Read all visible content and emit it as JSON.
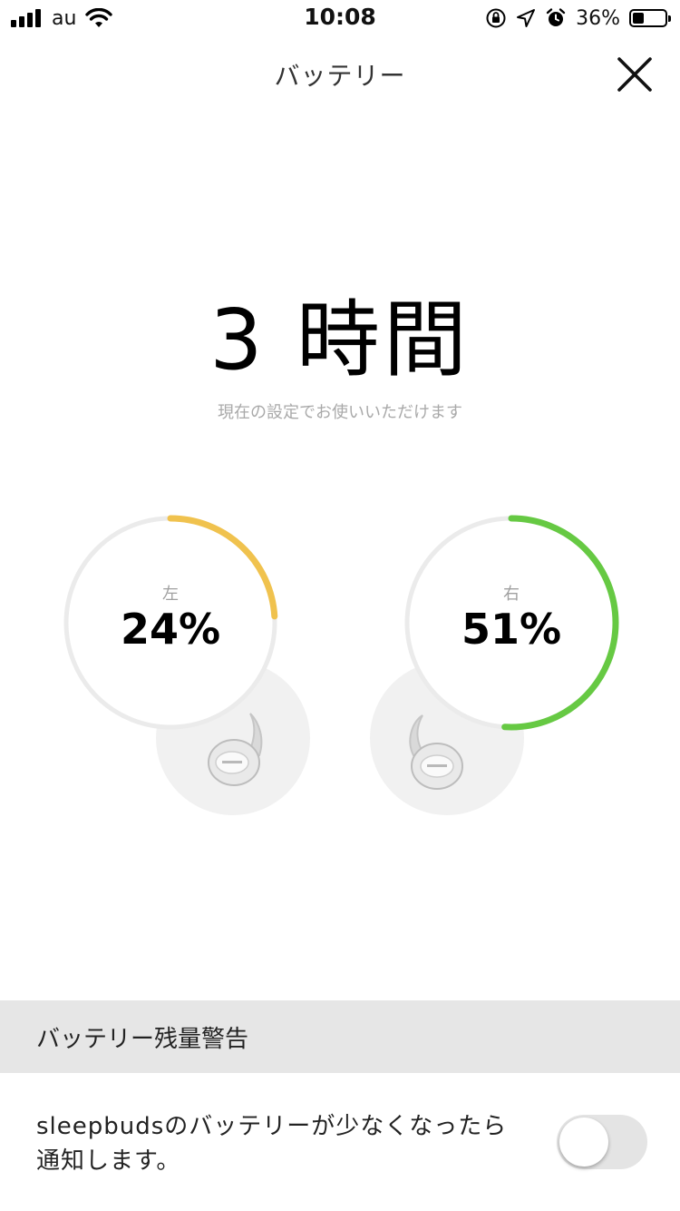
{
  "status_bar": {
    "carrier": "au",
    "time": "10:08",
    "battery_text": "36%",
    "battery_level": 0.36,
    "icons": [
      "signal-icon",
      "wifi-icon",
      "orientation-lock-icon",
      "location-icon",
      "alarm-icon",
      "battery-icon"
    ]
  },
  "header": {
    "title": "バッテリー",
    "close_icon": "close-icon"
  },
  "hero": {
    "remaining": "3 時間",
    "subtitle": "現在の設定でお使いいただけます"
  },
  "left_bud": {
    "side": "左",
    "percent_text": "24%",
    "percent": 24,
    "color": "#f0c24e"
  },
  "right_bud": {
    "side": "右",
    "percent_text": "51%",
    "percent": 51,
    "color": "#66c943"
  },
  "gauge_track_color": "#ebebeb",
  "settings": {
    "section_title": "バッテリー残量警告",
    "alert_description": "sleepbudsのバッテリーが少なくなったら通知します。",
    "alert_enabled": false
  }
}
